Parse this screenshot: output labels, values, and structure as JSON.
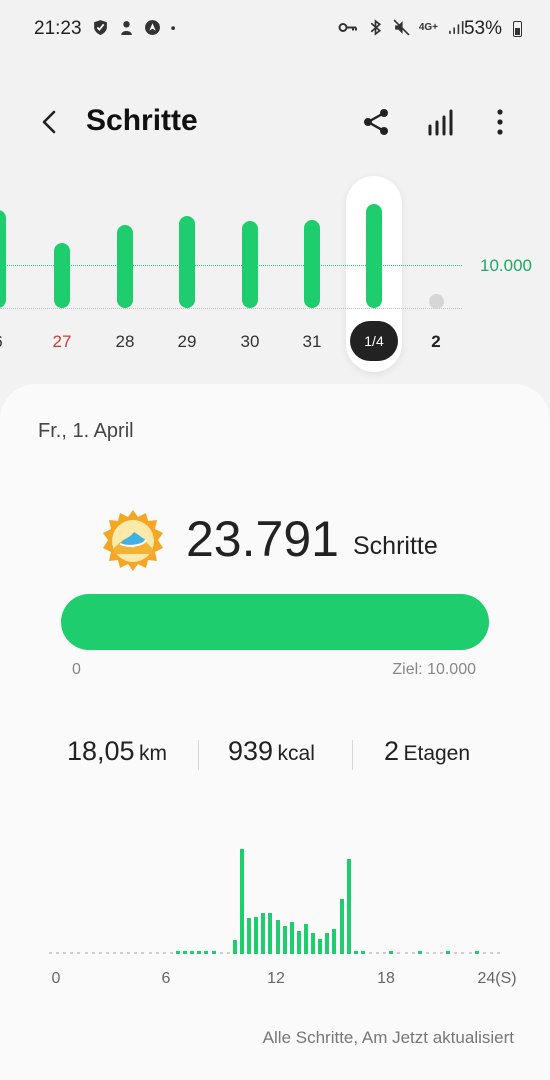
{
  "status_bar": {
    "time": "21:23",
    "network": "4G+",
    "battery": "53%"
  },
  "header": {
    "title": "Schritte"
  },
  "day_chart": {
    "goal_label": "10.000",
    "days": [
      {
        "label": "6",
        "color": "#333333"
      },
      {
        "label": "27",
        "color": "#c8403c"
      },
      {
        "label": "28",
        "color": "#333333"
      },
      {
        "label": "29",
        "color": "#333333"
      },
      {
        "label": "30",
        "color": "#333333"
      },
      {
        "label": "31",
        "color": "#333333"
      },
      {
        "label": "1/4",
        "color": "#ffffff"
      },
      {
        "label": "2",
        "color": "#222222"
      }
    ]
  },
  "summary": {
    "date": "Fr., 1. April",
    "steps_value": "23.791",
    "steps_unit": "Schritte",
    "progress_min": "0",
    "progress_goal": "Ziel: 10.000",
    "distance_value": "18,05",
    "distance_unit": "km",
    "calories_value": "939",
    "calories_unit": "kcal",
    "floors_value": "2",
    "floors_unit": "Etagen"
  },
  "hourly_chart": {
    "x_labels": [
      "0",
      "6",
      "12",
      "18",
      "24(S)"
    ]
  },
  "footer": {
    "text": "Alle Schritte, Am Jetzt aktualisiert"
  },
  "colors": {
    "accent": "#1ecd6e",
    "weekend_red": "#c8403c"
  }
}
